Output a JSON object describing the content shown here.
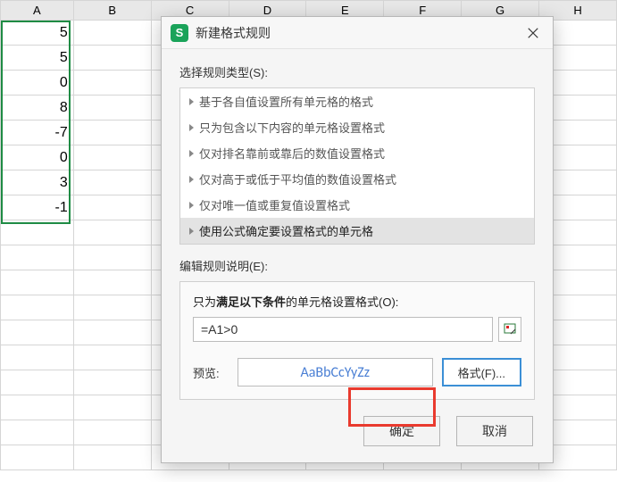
{
  "columns": [
    "A",
    "B",
    "C",
    "D",
    "E",
    "F",
    "G",
    "H"
  ],
  "cells": {
    "A": [
      "5",
      "5",
      "0",
      "8",
      "-7",
      "0",
      "3",
      "-1"
    ]
  },
  "dialog": {
    "title": "新建格式规则",
    "app_badge": "S",
    "section_rule_type": "选择规则类型(S):",
    "rule_types": [
      "基于各自值设置所有单元格的格式",
      "只为包含以下内容的单元格设置格式",
      "仅对排名靠前或靠后的数值设置格式",
      "仅对高于或低于平均值的数值设置格式",
      "仅对唯一值或重复值设置格式",
      "使用公式确定要设置格式的单元格"
    ],
    "selected_rule_index": 5,
    "section_edit": "编辑规则说明(E):",
    "condition_label_prefix": "只为",
    "condition_label_bold": "满足以下条件",
    "condition_label_suffix": "的单元格设置格式(O):",
    "formula_value": "=A1>0",
    "preview_label": "预览:",
    "preview_sample": "AaBbCcYyZz",
    "format_button": "格式(F)...",
    "ok": "确定",
    "cancel": "取消"
  }
}
